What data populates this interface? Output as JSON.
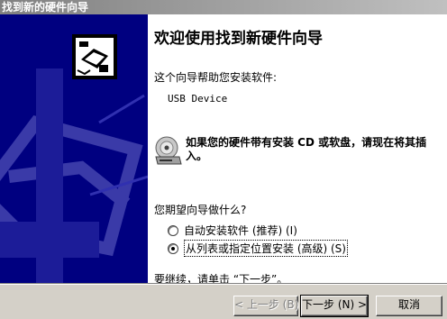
{
  "window": {
    "title": "找到新的硬件向导"
  },
  "main": {
    "heading": "欢迎使用找到新硬件向导",
    "intro": "这个向导帮助您安装软件:",
    "device_name": "USB Device",
    "cd_notice": "如果您的硬件带有安装 CD 或软盘，请现在将其插入。",
    "question": "您期望向导做什么?",
    "options": [
      {
        "label": "自动安装软件 (推荐) (I)",
        "selected": false
      },
      {
        "label": "从列表或指定位置安装 (高级) (S)",
        "selected": true
      }
    ],
    "continue_text": "要继续，请单击 “下一步”。"
  },
  "buttons": {
    "back": "< 上一步 (B)",
    "next": "下一步 (N) >",
    "cancel": "取消"
  },
  "icons": {
    "sidebar": "hardware-wizard-icon",
    "cd": "cd-drive-icon"
  }
}
